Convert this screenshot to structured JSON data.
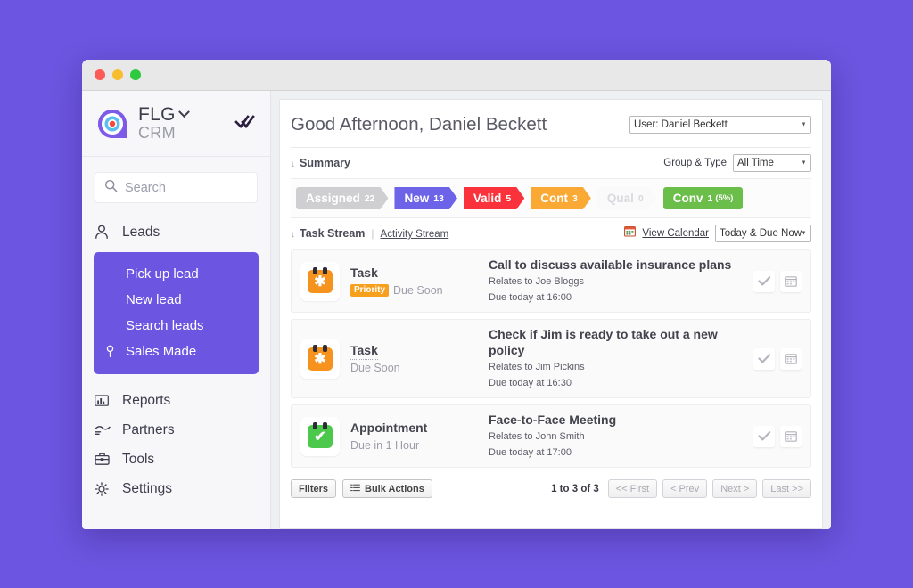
{
  "window": {
    "traffic_lights": [
      "close",
      "minimize",
      "zoom"
    ]
  },
  "sidebar": {
    "brand": {
      "name": "FLG",
      "subtitle": "CRM",
      "logo_icon": "flg-target-pin-logo",
      "caret_icon": "chevron-down-icon",
      "check_icon": "double-check-icon"
    },
    "search": {
      "placeholder": "Search",
      "value": "",
      "icon": "search-icon"
    },
    "leads": {
      "label": "Leads",
      "icon": "person-icon"
    },
    "submenu": [
      {
        "label": "Pick up lead",
        "icon": ""
      },
      {
        "label": "New lead",
        "icon": ""
      },
      {
        "label": "Search leads",
        "icon": ""
      },
      {
        "label": "Sales Made",
        "icon": "pin-icon"
      }
    ],
    "lower_items": [
      {
        "label": "Reports",
        "icon": "bar-chart-icon"
      },
      {
        "label": "Partners",
        "icon": "handshake-icon"
      },
      {
        "label": "Tools",
        "icon": "toolbox-icon"
      },
      {
        "label": "Settings",
        "icon": "gear-icon"
      }
    ],
    "accent_color": "#6C55E0"
  },
  "header": {
    "greeting": "Good Afternoon, Daniel Beckett",
    "user_select": {
      "value": "User: Daniel Beckett",
      "options": [
        "User: Daniel Beckett"
      ]
    }
  },
  "summary": {
    "caret_icon": "caret-down-icon",
    "title": "Summary",
    "group_type_link": "Group & Type",
    "range_select": {
      "value": "All Time",
      "options": [
        "All Time"
      ]
    },
    "funnel": [
      {
        "label": "Assigned",
        "count": "22",
        "pct": "",
        "color": "#CFCFD2",
        "text_color": "#ffffff"
      },
      {
        "label": "New",
        "count": "13",
        "pct": "",
        "color": "#6C63E8",
        "text_color": "#ffffff"
      },
      {
        "label": "Valid",
        "count": "5",
        "pct": "",
        "color": "#F9323C",
        "text_color": "#ffffff"
      },
      {
        "label": "Cont",
        "count": "3",
        "pct": "",
        "color": "#F9A934",
        "text_color": "#ffffff"
      },
      {
        "label": "Qual",
        "count": "0",
        "pct": "",
        "color": "#FAFAFA",
        "text_color": "#D9D9DE"
      },
      {
        "label": "Conv",
        "count": "1",
        "pct": "(5%)",
        "color": "#6CBE4B",
        "text_color": "#ffffff"
      }
    ]
  },
  "task_stream": {
    "caret_icon": "caret-down-icon",
    "title": "Task Stream",
    "divider": "|",
    "activity_link": "Activity Stream",
    "calendar_icon": "calendar-icon",
    "calendar_link": "View Calendar",
    "filter_select": {
      "value": "Today & Due Now",
      "options": [
        "Today & Due Now"
      ]
    },
    "rows": [
      {
        "icon": "task-star-icon",
        "icon_color": "orange",
        "glyph": "✱",
        "type": "Task",
        "priority": "Priority",
        "due_label": "Due Soon",
        "title": "Call to discuss available insurance plans",
        "relates": "Relates to Joe Bloggs",
        "due": "Due today at 16:00",
        "actions": [
          "complete-check-icon",
          "calendar-icon"
        ]
      },
      {
        "icon": "task-star-icon",
        "icon_color": "orange",
        "glyph": "✱",
        "type": "Task",
        "priority": "",
        "due_label": "Due Soon",
        "title": "Check if Jim is ready to take out a new policy",
        "relates": "Relates to Jim Pickins",
        "due": "Due today at 16:30",
        "actions": [
          "complete-check-icon",
          "calendar-icon"
        ]
      },
      {
        "icon": "appointment-check-icon",
        "icon_color": "green",
        "glyph": "✔",
        "type": "Appointment",
        "priority": "",
        "due_label": "Due in 1 Hour",
        "title": "Face-to-Face Meeting",
        "relates": "Relates to John Smith",
        "due": "Due today at 17:00",
        "actions": [
          "complete-check-icon",
          "calendar-icon"
        ]
      }
    ]
  },
  "footer": {
    "filters_label": "Filters",
    "bulk_actions_label": "Bulk Actions",
    "bulk_icon": "list-icon",
    "pager_count": "1 to 3 of 3",
    "pager_buttons": [
      "<< First",
      "< Prev",
      "Next >",
      "Last >>"
    ]
  }
}
